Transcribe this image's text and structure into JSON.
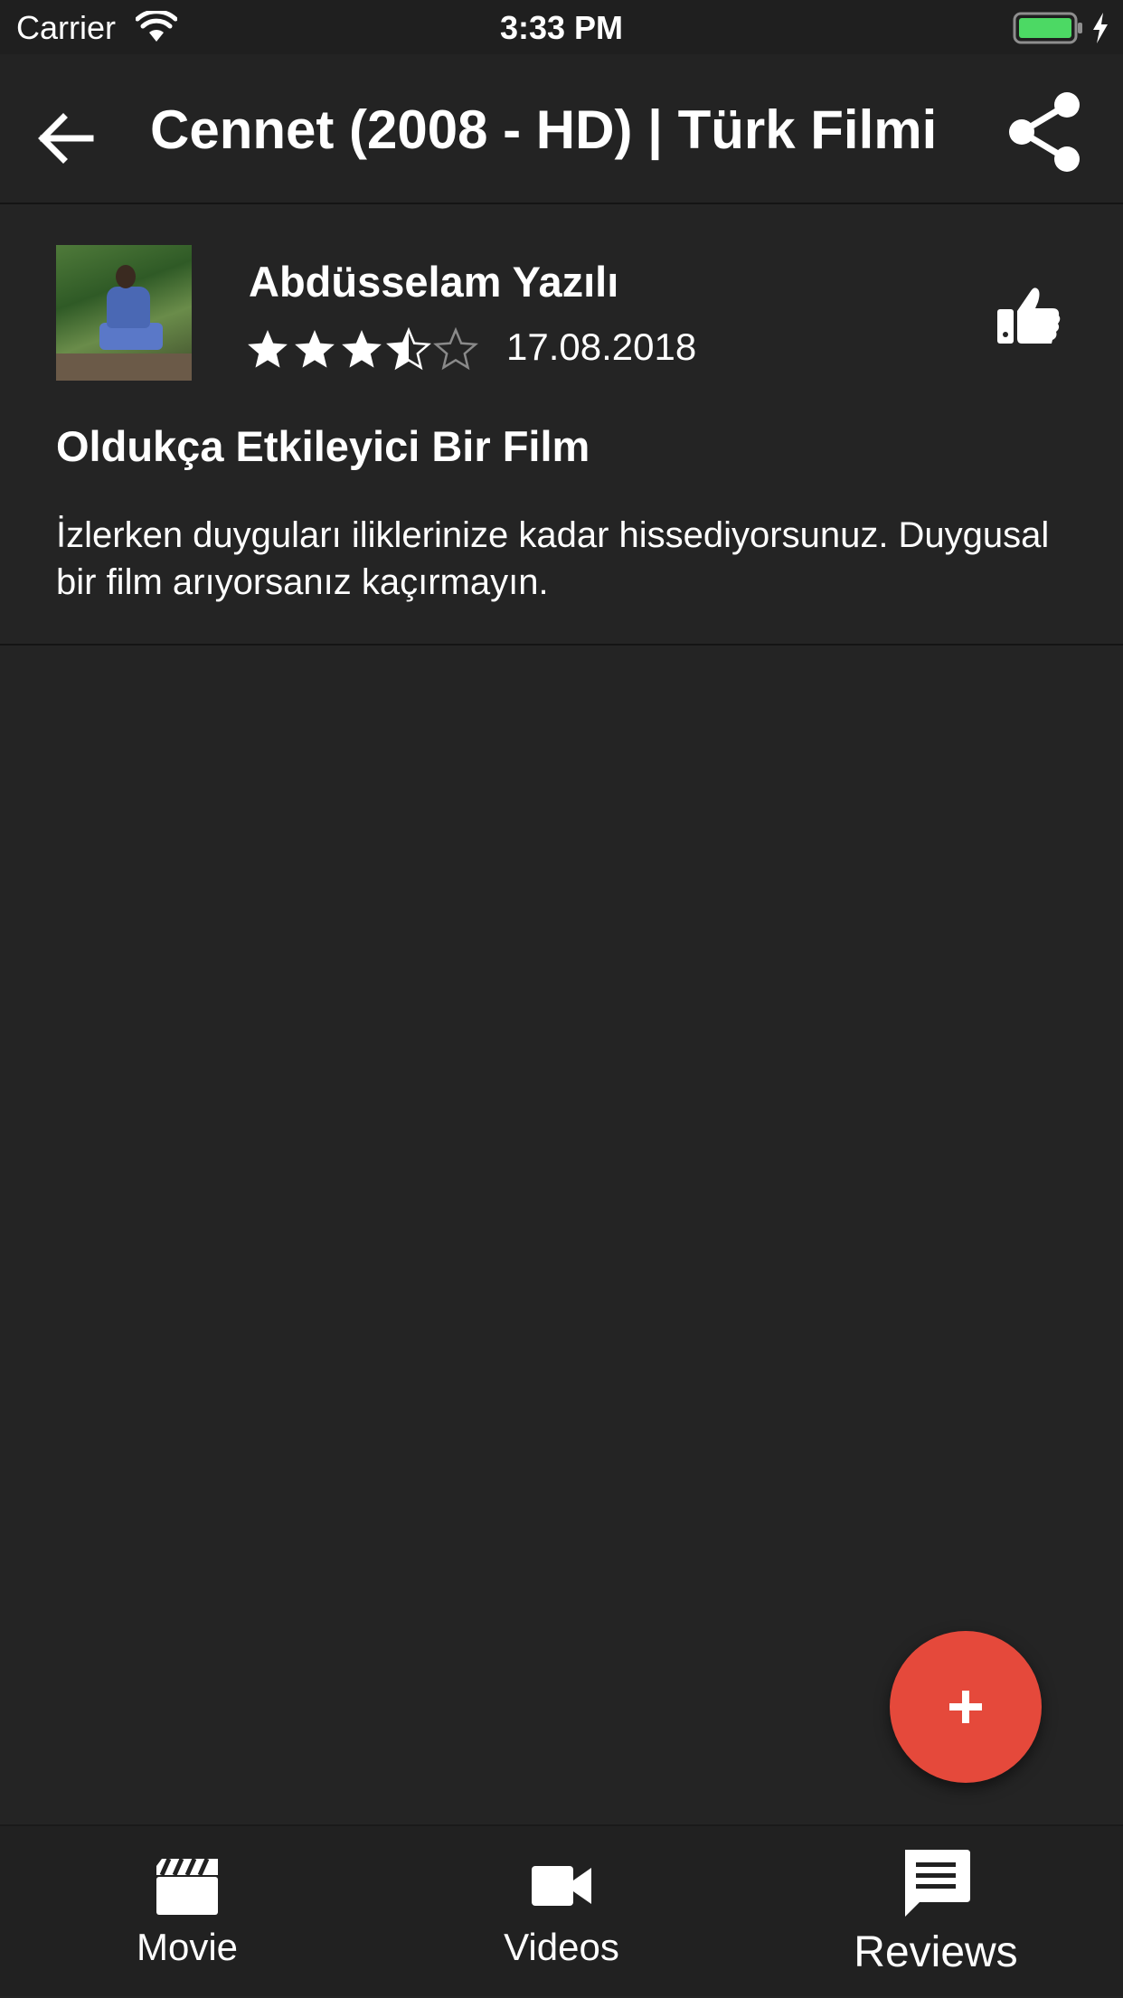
{
  "status_bar": {
    "carrier": "Carrier",
    "time": "3:33 PM",
    "battery_color": "#4cd964"
  },
  "app_bar": {
    "title": "Cennet (2008 - HD) | Türk Filmi",
    "back_icon": "arrow-back-icon",
    "share_icon": "share-icon"
  },
  "review": {
    "reviewer_name": "Abdüsselam Yazılı",
    "rating": 3.5,
    "rating_max": 5,
    "date": "17.08.2018",
    "title": "Oldukça Etkileyici Bir Film",
    "body": "İzlerken duyguları iliklerinize kadar hissediyorsunuz. Duygusal bir film arıyorsanız kaçırmayın.",
    "like_icon": "thumbs-up-icon"
  },
  "fab": {
    "icon": "plus-icon",
    "color": "#e5493b"
  },
  "bottom_nav": {
    "tabs": [
      {
        "label": "Movie",
        "icon": "clapperboard-icon"
      },
      {
        "label": "Videos",
        "icon": "video-camera-icon"
      },
      {
        "label": "Reviews",
        "icon": "reviews-icon",
        "selected": true
      }
    ]
  }
}
